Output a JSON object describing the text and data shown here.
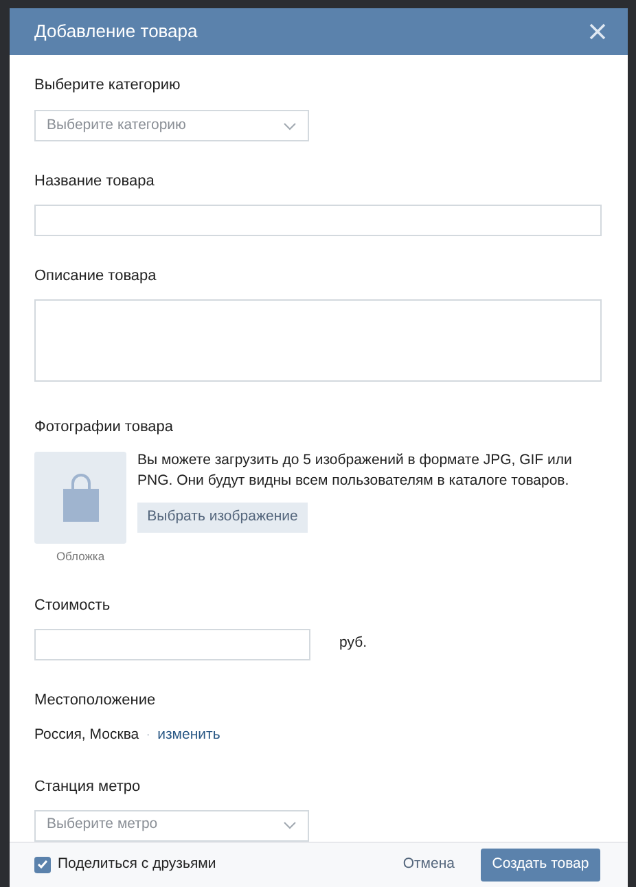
{
  "window": {
    "title": "Добавление товара"
  },
  "category": {
    "label": "Выберите категорию",
    "placeholder": "Выберите категорию"
  },
  "name": {
    "label": "Название товара"
  },
  "description": {
    "label": "Описание товара"
  },
  "photos": {
    "label": "Фотографии товара",
    "cover_caption": "Обложка",
    "hint": "Вы можете загрузить до 5 изображений в формате JPG, GIF или PNG. Они будут видны всем пользователям в каталоге товаров.",
    "button": "Выбрать изображение"
  },
  "price": {
    "label": "Стоимость",
    "unit": "руб."
  },
  "location": {
    "label": "Местоположение",
    "value": "Россия, Москва",
    "separator": "·",
    "change_link": "изменить"
  },
  "metro": {
    "label": "Станция метро",
    "placeholder": "Выберите метро"
  },
  "footer": {
    "share": {
      "label": "Поделиться с друзьями",
      "checked": true
    },
    "cancel": "Отмена",
    "submit": "Создать товар"
  }
}
